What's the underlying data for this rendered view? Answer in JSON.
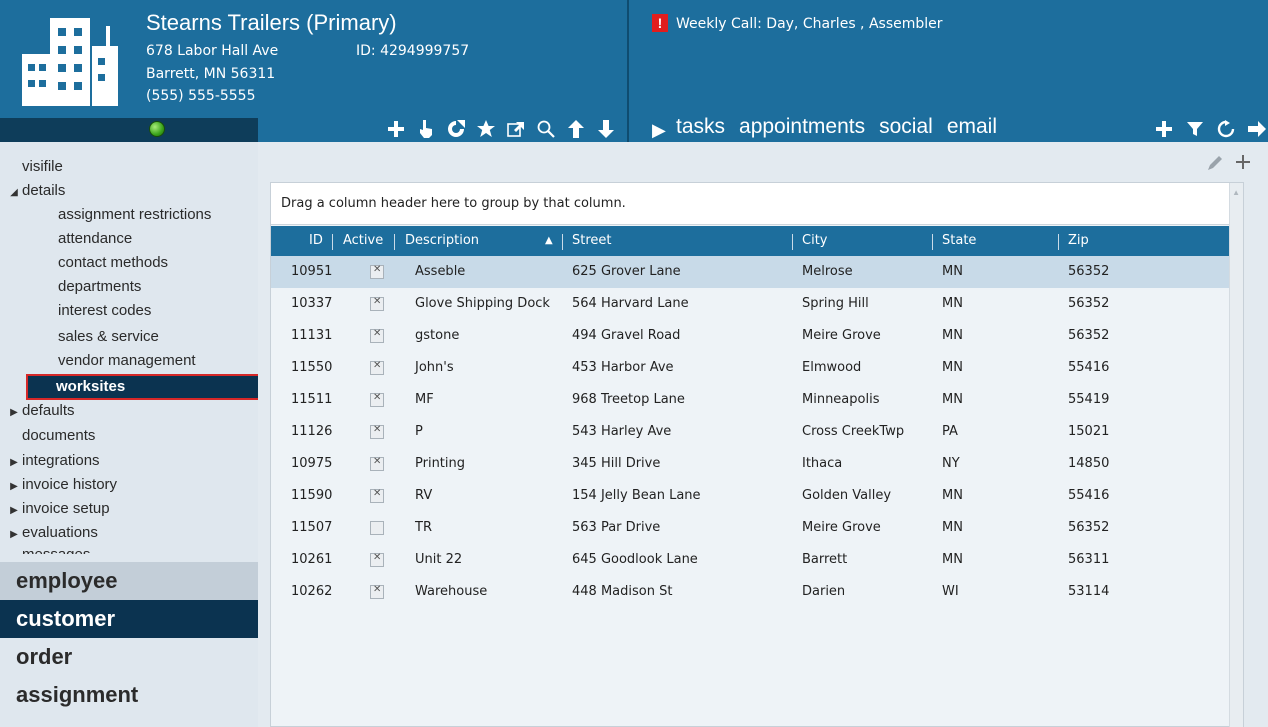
{
  "header": {
    "company_name": "Stearns Trailers (Primary)",
    "address_line1": "678 Labor Hall Ave",
    "address_line2": "Barrett, MN  56311",
    "phone": "(555) 555-5555",
    "company_id": "ID:  4294999757",
    "alert_icon_text": "!",
    "alert_text": "Weekly Call: Day, Charles , Assembler",
    "status_color": "#3aa31a",
    "toolbar_icons": [
      "plus-icon",
      "point-icon",
      "merge-icon",
      "star-icon",
      "external-link-icon",
      "search-icon",
      "up-arrow-icon",
      "down-arrow-icon"
    ],
    "nav_tabs": [
      "tasks",
      "appointments",
      "social",
      "email"
    ],
    "right_icons": [
      "plus-icon",
      "filter-icon",
      "refresh-icon",
      "arrow-right-icon"
    ]
  },
  "sidebar": {
    "tree": {
      "visifile": "visifile",
      "details": "details",
      "assignment_restrictions": "assignment restrictions",
      "attendance": "attendance",
      "contact_methods": "contact methods",
      "departments": "departments",
      "interest_codes": "interest codes",
      "sales_service": "sales & service",
      "vendor_management": "vendor management",
      "worksites": "worksites",
      "defaults": "defaults",
      "documents": "documents",
      "integrations": "integrations",
      "invoice_history": "invoice history",
      "invoice_setup": "invoice setup",
      "evaluations": "evaluations",
      "messages": "messages"
    },
    "modules": {
      "employee": "employee",
      "customer": "customer",
      "order": "order",
      "assignment": "assignment"
    }
  },
  "grid": {
    "group_hint": "Drag a column header here to group by that column.",
    "columns": {
      "id": "ID",
      "active": "Active",
      "description": "Description",
      "street": "Street",
      "city": "City",
      "state": "State",
      "zip": "Zip"
    },
    "sort_indicator": "▲",
    "rows": [
      {
        "id": "10951",
        "active": true,
        "description": "Asseble",
        "street": "625 Grover Lane",
        "city": "Melrose",
        "state": "MN",
        "zip": "56352"
      },
      {
        "id": "10337",
        "active": true,
        "description": "Glove Shipping Dock",
        "street": "564 Harvard Lane",
        "city": "Spring Hill",
        "state": "MN",
        "zip": "56352"
      },
      {
        "id": "11131",
        "active": true,
        "description": "gstone",
        "street": "494 Gravel Road",
        "city": "Meire Grove",
        "state": "MN",
        "zip": "56352"
      },
      {
        "id": "11550",
        "active": true,
        "description": "John's",
        "street": "453 Harbor Ave",
        "city": "Elmwood",
        "state": "MN",
        "zip": "55416"
      },
      {
        "id": "11511",
        "active": true,
        "description": "MF",
        "street": "968 Treetop Lane",
        "city": "Minneapolis",
        "state": "MN",
        "zip": "55419"
      },
      {
        "id": "11126",
        "active": true,
        "description": "P",
        "street": "543 Harley Ave",
        "city": "Cross CreekTwp",
        "state": "PA",
        "zip": "15021"
      },
      {
        "id": "10975",
        "active": true,
        "description": "Printing",
        "street": "345 Hill Drive",
        "city": "Ithaca",
        "state": "NY",
        "zip": "14850"
      },
      {
        "id": "11590",
        "active": true,
        "description": "RV",
        "street": "154 Jelly Bean Lane",
        "city": "Golden Valley",
        "state": "MN",
        "zip": "55416"
      },
      {
        "id": "11507",
        "active": false,
        "description": "TR",
        "street": "563 Par Drive",
        "city": "Meire Grove",
        "state": "MN",
        "zip": "56352"
      },
      {
        "id": "10261",
        "active": true,
        "description": "Unit 22",
        "street": "645 Goodlook Lane",
        "city": "Barrett",
        "state": "MN",
        "zip": "56311"
      },
      {
        "id": "10262",
        "active": true,
        "description": "Warehouse",
        "street": "448 Madison St",
        "city": "Darien",
        "state": "WI",
        "zip": "53114"
      }
    ]
  }
}
